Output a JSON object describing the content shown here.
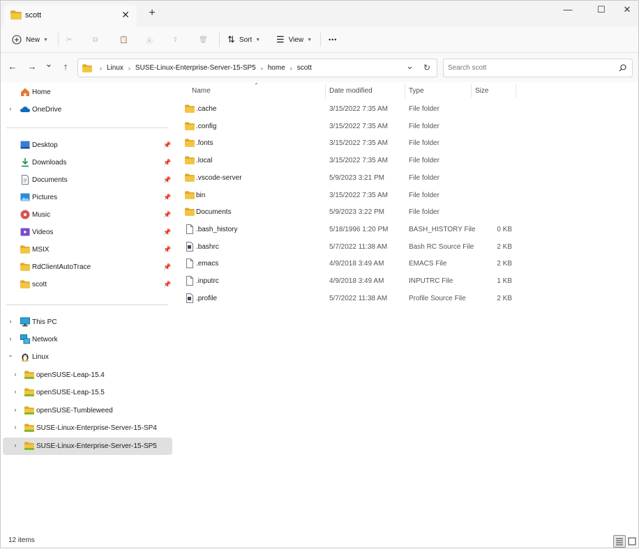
{
  "window": {
    "tab_title": "scott",
    "new_tab": "+",
    "minimize": "—",
    "maximize": "☐",
    "close": "✕",
    "tab_close": "✕"
  },
  "toolbar": {
    "new_label": "New",
    "sort_label": "Sort",
    "view_label": "View",
    "more_label": "•••"
  },
  "nav": {
    "back": "←",
    "forward": "→",
    "recent": "⌄",
    "up": "↑",
    "breadcrumbs": [
      "Linux",
      "SUSE-Linux-Enterprise-Server-15-SP5",
      "home",
      "scott"
    ],
    "dropdown": "⌄",
    "refresh": "↻",
    "search_placeholder": "Search scott"
  },
  "sidebar": {
    "top": [
      {
        "label": "Home",
        "icon": "home-icon",
        "chevron": ""
      },
      {
        "label": "OneDrive",
        "icon": "cloud-icon",
        "chevron": "›"
      }
    ],
    "pinned": [
      {
        "label": "Desktop",
        "icon": "desktop-icon"
      },
      {
        "label": "Downloads",
        "icon": "download-icon"
      },
      {
        "label": "Documents",
        "icon": "document-icon"
      },
      {
        "label": "Pictures",
        "icon": "pictures-icon"
      },
      {
        "label": "Music",
        "icon": "music-icon"
      },
      {
        "label": "Videos",
        "icon": "videos-icon"
      },
      {
        "label": "MSIX",
        "icon": "folder-icon"
      },
      {
        "label": "RdClientAutoTrace",
        "icon": "folder-icon"
      },
      {
        "label": "scott",
        "icon": "folder-icon"
      }
    ],
    "pin_glyph": "📌",
    "bottom": [
      {
        "label": "This PC",
        "icon": "monitor-icon",
        "chevron": "›"
      },
      {
        "label": "Network",
        "icon": "network-icon",
        "chevron": "›"
      },
      {
        "label": "Linux",
        "icon": "linux-icon",
        "chevron": "⌄"
      }
    ],
    "linux_children": [
      {
        "label": "openSUSE-Leap-15.4"
      },
      {
        "label": "openSUSE-Leap-15.5"
      },
      {
        "label": "openSUSE-Tumbleweed"
      },
      {
        "label": "SUSE-Linux-Enterprise-Server-15-SP4"
      },
      {
        "label": "SUSE-Linux-Enterprise-Server-15-SP5",
        "selected": true
      }
    ]
  },
  "columns": {
    "name": "Name",
    "date": "Date modified",
    "type": "Type",
    "size": "Size"
  },
  "files": [
    {
      "name": ".cache",
      "date": "3/15/2022 7:35 AM",
      "type": "File folder",
      "size": "",
      "kind": "folder"
    },
    {
      "name": ".config",
      "date": "3/15/2022 7:35 AM",
      "type": "File folder",
      "size": "",
      "kind": "folder"
    },
    {
      "name": ".fonts",
      "date": "3/15/2022 7:35 AM",
      "type": "File folder",
      "size": "",
      "kind": "folder"
    },
    {
      "name": ".local",
      "date": "3/15/2022 7:35 AM",
      "type": "File folder",
      "size": "",
      "kind": "folder"
    },
    {
      "name": ".vscode-server",
      "date": "5/9/2023 3:21 PM",
      "type": "File folder",
      "size": "",
      "kind": "folder"
    },
    {
      "name": "bin",
      "date": "3/15/2022 7:35 AM",
      "type": "File folder",
      "size": "",
      "kind": "folder"
    },
    {
      "name": "Documents",
      "date": "5/9/2023 3:22 PM",
      "type": "File folder",
      "size": "",
      "kind": "folder"
    },
    {
      "name": ".bash_history",
      "date": "5/18/1996 1:20 PM",
      "type": "BASH_HISTORY File",
      "size": "0 KB",
      "kind": "file"
    },
    {
      "name": ".bashrc",
      "date": "5/7/2022 11:38 AM",
      "type": "Bash RC Source File",
      "size": "2 KB",
      "kind": "script"
    },
    {
      "name": ".emacs",
      "date": "4/9/2018 3:49 AM",
      "type": "EMACS File",
      "size": "2 KB",
      "kind": "file"
    },
    {
      "name": ".inputrc",
      "date": "4/9/2018 3:49 AM",
      "type": "INPUTRC File",
      "size": "1 KB",
      "kind": "file"
    },
    {
      "name": ".profile",
      "date": "5/7/2022 11:38 AM",
      "type": "Profile Source File",
      "size": "2 KB",
      "kind": "script"
    }
  ],
  "status": {
    "item_count": "12 items"
  },
  "colors": {
    "folder": "#f3c544",
    "folder_dark": "#e0a825",
    "accent": "#0067c0"
  }
}
